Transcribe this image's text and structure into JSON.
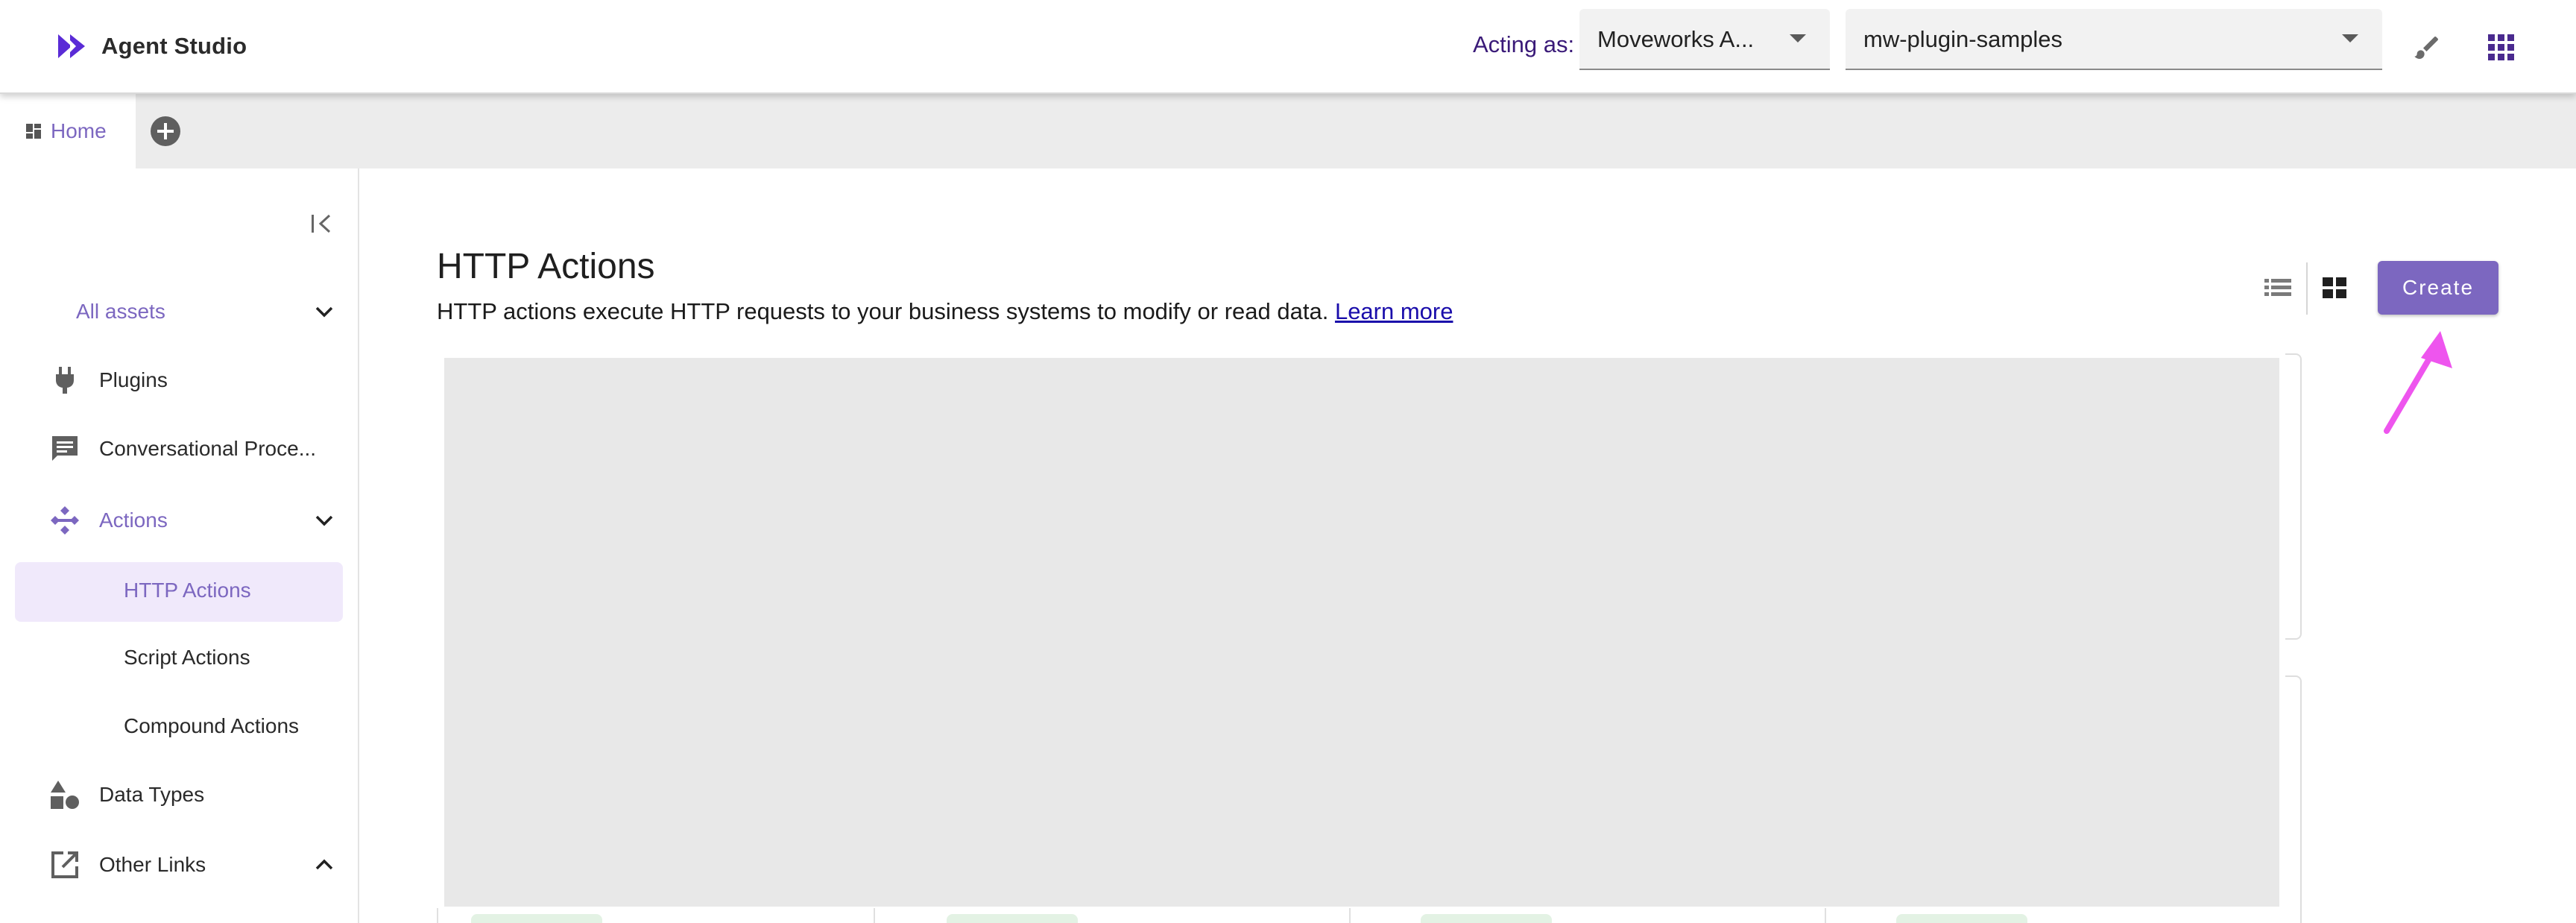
{
  "header": {
    "app_name": "Agent Studio",
    "acting_label": "Acting as:",
    "org_select": "Moveworks A...",
    "workspace_select": "mw-plugin-samples",
    "brand_color": "#5a2bd6"
  },
  "tabs": {
    "home_label": "Home"
  },
  "sidebar": {
    "all_assets": "All assets",
    "items": [
      {
        "label": "Plugins",
        "icon": "plug-icon"
      },
      {
        "label": "Conversational Proce...",
        "icon": "chat-icon"
      },
      {
        "label": "Actions",
        "icon": "actions-icon"
      },
      {
        "label": "Data Types",
        "icon": "shapes-icon"
      },
      {
        "label": "Other Links",
        "icon": "external-link-icon"
      }
    ],
    "sub_items": [
      {
        "label": "HTTP Actions",
        "active": true
      },
      {
        "label": "Script Actions",
        "active": false
      },
      {
        "label": "Compound Actions",
        "active": false
      }
    ]
  },
  "main": {
    "title": "HTTP Actions",
    "description": "HTTP actions execute HTTP requests to your business systems to modify or read data.",
    "learn_more": "Learn more",
    "create_label": "Create",
    "accent_color": "#7c67c0",
    "annotation_arrow_color": "#ee55ee"
  }
}
